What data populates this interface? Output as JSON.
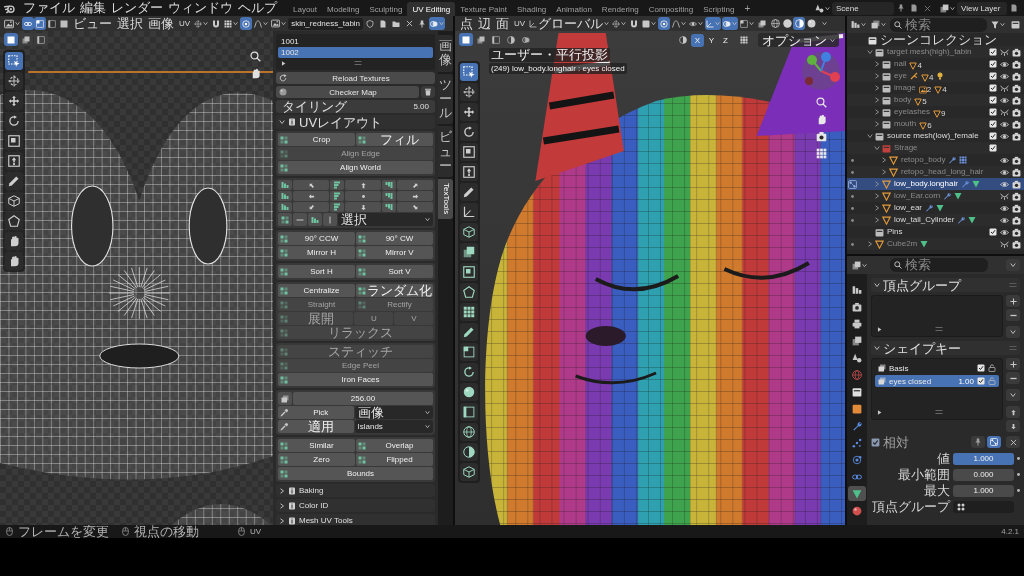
{
  "top_bar": {
    "menus": [
      "ファイル",
      "編集",
      "レンダー",
      "ウィンドウ",
      "ヘルプ"
    ],
    "workspaces": [
      {
        "label": "Layout",
        "selected": false
      },
      {
        "label": "Modeling",
        "selected": false
      },
      {
        "label": "Sculpting",
        "selected": false
      },
      {
        "label": "UV Editing",
        "selected": true
      },
      {
        "label": "Texture Paint",
        "selected": false
      },
      {
        "label": "Shading",
        "selected": false
      },
      {
        "label": "Animation",
        "selected": false
      },
      {
        "label": "Rendering",
        "selected": false
      },
      {
        "label": "Compositing",
        "selected": false
      },
      {
        "label": "Scripting",
        "selected": false
      }
    ],
    "add_workspace": "+",
    "scene": "Scene",
    "view_layer": "View Layer"
  },
  "uv_editor": {
    "select_toggles": [
      {
        "kind": "sync",
        "selected": true
      },
      {
        "kind": "vertex",
        "selected": true
      },
      {
        "kind": "edge",
        "selected": false
      },
      {
        "kind": "face",
        "selected": false
      }
    ],
    "menus": [
      "ビュー",
      "選択",
      "画像",
      "UV"
    ],
    "header_tools": [
      {
        "kind": "pivot",
        "selected": false
      },
      {
        "kind": "snap",
        "selected": false
      },
      {
        "kind": "snap_target",
        "selected": false
      },
      {
        "kind": "proportional",
        "selected": true
      },
      {
        "kind": "falloff",
        "selected": false
      }
    ],
    "image_name": "skin_redness_tabin",
    "overlay": {
      "selected": true
    },
    "select_modes": [
      {
        "kind": "set",
        "selected": true
      },
      {
        "kind": "extend",
        "selected": false
      },
      {
        "kind": "subtract",
        "selected": false
      }
    ],
    "tools": [
      {
        "kind": "select",
        "selected": true
      },
      {
        "kind": "cursor",
        "selected": false
      },
      {
        "kind": "move",
        "selected": false
      },
      {
        "kind": "rotate",
        "selected": false
      },
      {
        "kind": "scale",
        "selected": false
      },
      {
        "kind": "transform",
        "selected": false
      },
      {
        "kind": "annotate",
        "selected": false
      },
      {
        "kind": "rip",
        "selected": false
      },
      {
        "kind": "region",
        "selected": false
      },
      {
        "kind": "grab",
        "selected": false
      },
      {
        "kind": "pinch",
        "selected": false
      }
    ]
  },
  "sidebar": {
    "tiles": [
      {
        "label": "1001",
        "selected": false
      },
      {
        "label": "1002",
        "selected": true
      }
    ],
    "reload_button": "Reload Textures",
    "checker_button": "Checker Map",
    "tiling": {
      "label": "タイリング",
      "value": "5.00"
    },
    "layout_panel": {
      "title": "UVレイアウト",
      "expanded": true,
      "groups": [
        {
          "rows": [
            {
              "kind": "buttons",
              "buttons": [
                {
                  "label": "Crop",
                  "disabled": false
                },
                {
                  "label": "フィル",
                  "disabled": false
                }
              ]
            },
            {
              "kind": "buttons",
              "buttons": [
                {
                  "label": "Align Edge",
                  "disabled": true
                }
              ]
            },
            {
              "kind": "buttons",
              "buttons": [
                {
                  "label": "Align World",
                  "disabled": false
                }
              ]
            }
          ]
        },
        {
          "rows": [
            {
              "kind": "align_grid"
            },
            {
              "kind": "align_select",
              "dropdown": "選択"
            }
          ]
        },
        {
          "rows": [
            {
              "kind": "buttons",
              "buttons": [
                {
                  "label": "90° CCW",
                  "disabled": false
                },
                {
                  "label": "90° CW",
                  "disabled": false
                }
              ]
            },
            {
              "kind": "buttons",
              "buttons": [
                {
                  "label": "Mirror H",
                  "disabled": false
                },
                {
                  "label": "Mirror V",
                  "disabled": false
                }
              ]
            }
          ]
        },
        {
          "rows": [
            {
              "kind": "buttons",
              "buttons": [
                {
                  "label": "Sort H",
                  "disabled": false
                },
                {
                  "label": "Sort V",
                  "disabled": false
                }
              ]
            }
          ]
        },
        {
          "rows": [
            {
              "kind": "buttons",
              "buttons": [
                {
                  "label": "Centralize",
                  "disabled": false
                },
                {
                  "label": "ランダム化",
                  "disabled": false
                }
              ]
            },
            {
              "kind": "buttons",
              "buttons": [
                {
                  "label": "Straight",
                  "disabled": true
                },
                {
                  "label": "Rectify",
                  "disabled": true
                }
              ]
            },
            {
              "kind": "buttons",
              "buttons": [
                {
                  "label": "展開",
                  "disabled": true
                },
                {
                  "label": "U",
                  "disabled": true
                },
                {
                  "label": "V",
                  "disabled": true
                }
              ]
            },
            {
              "kind": "buttons",
              "buttons": [
                {
                  "label": "リラックス",
                  "disabled": true
                }
              ]
            }
          ]
        },
        {
          "rows": [
            {
              "kind": "buttons",
              "buttons": [
                {
                  "label": "スティッチ",
                  "disabled": true
                }
              ]
            },
            {
              "kind": "buttons",
              "buttons": [
                {
                  "label": "Edge Peel",
                  "disabled": true
                }
              ]
            },
            {
              "kind": "buttons",
              "buttons": [
                {
                  "label": "Iron Faces",
                  "disabled": false
                }
              ]
            }
          ]
        },
        {
          "rows": [
            {
              "kind": "value",
              "value": "256.00"
            },
            {
              "kind": "pick",
              "button": {
                "label": "Pick",
                "disabled": false
              },
              "dropdown": "画像"
            },
            {
              "kind": "pick",
              "button": {
                "label": "適用",
                "disabled": false
              },
              "dropdown": "Islands"
            }
          ]
        },
        {
          "rows": [
            {
              "kind": "buttons",
              "buttons": [
                {
                  "label": "Similar",
                  "disabled": false
                },
                {
                  "label": "Overlap",
                  "disabled": false
                }
              ]
            },
            {
              "kind": "buttons",
              "buttons": [
                {
                  "label": "Zero",
                  "disabled": false
                },
                {
                  "label": "Flipped",
                  "disabled": false
                }
              ]
            },
            {
              "kind": "buttons",
              "buttons": [
                {
                  "label": "Bounds",
                  "disabled": false
                }
              ]
            }
          ]
        }
      ]
    },
    "collapsed_panels": [
      {
        "title": "Baking",
        "expanded": false
      },
      {
        "title": "Color ID",
        "expanded": false
      },
      {
        "title": "Mesh UV Tools",
        "expanded": false
      }
    ],
    "tabs": [
      {
        "label": "画像",
        "selected": false,
        "kind": "stacked"
      },
      {
        "label": "ツール",
        "selected": false,
        "kind": "stacked"
      },
      {
        "label": "ビュー",
        "selected": false,
        "kind": "stacked"
      },
      {
        "label": "TexTools",
        "selected": true,
        "kind": "rotated"
      }
    ]
  },
  "viewport": {
    "menus": [
      "点",
      "辺",
      "面",
      "UV"
    ],
    "orientation": "グローバル",
    "header_tools": [
      {
        "kind": "pivot",
        "selected": false
      },
      {
        "kind": "snap",
        "selected": false
      },
      {
        "kind": "snap_increment",
        "selected": false
      },
      {
        "kind": "proportional",
        "selected": true
      },
      {
        "kind": "falloff",
        "selected": false
      }
    ],
    "display_toggles": [
      {
        "kind": "visibility",
        "selected": false
      },
      {
        "kind": "gizmo",
        "selected": true
      },
      {
        "kind": "overlay",
        "selected": true
      },
      {
        "kind": "mesh_overlay",
        "selected": false
      },
      {
        "kind": "xray",
        "selected": false
      }
    ],
    "shading": [
      {
        "kind": "wireframe",
        "selected": false
      },
      {
        "kind": "solid",
        "selected": false
      },
      {
        "kind": "material",
        "selected": true
      },
      {
        "kind": "rendered",
        "selected": false
      }
    ],
    "select_modes": [
      {
        "kind": "set",
        "selected": true
      },
      {
        "kind": "extend",
        "selected": false
      },
      {
        "kind": "subtract",
        "selected": false
      },
      {
        "kind": "invert",
        "selected": false
      },
      {
        "kind": "intersect",
        "selected": false
      }
    ],
    "mirror": [
      {
        "label": "X",
        "selected": true
      },
      {
        "label": "Y",
        "selected": false
      },
      {
        "label": "Z",
        "selected": false
      }
    ],
    "options": "オプション",
    "view_name": "ユーザー・平行投影",
    "object_info": "(249) low_body.longhair : eyes closed",
    "tools": [
      {
        "kind": "select",
        "selected": true
      },
      {
        "kind": "cursor",
        "selected": false
      },
      {
        "kind": "move",
        "selected": false
      },
      {
        "kind": "rotate",
        "selected": false
      },
      {
        "kind": "scale",
        "selected": false
      },
      {
        "kind": "transform",
        "selected": false
      },
      {
        "kind": "annotate",
        "selected": false
      },
      {
        "kind": "measure",
        "selected": false
      },
      {
        "kind": "add_cube",
        "selected": false
      },
      {
        "kind": "extrude",
        "selected": false
      },
      {
        "kind": "inset",
        "selected": false
      },
      {
        "kind": "bevel",
        "selected": false
      },
      {
        "kind": "loop_cut",
        "selected": false
      },
      {
        "kind": "knife",
        "selected": false
      },
      {
        "kind": "poly_build",
        "selected": false
      },
      {
        "kind": "spin",
        "selected": false
      },
      {
        "kind": "smooth",
        "selected": false
      },
      {
        "kind": "edge_slide",
        "selected": false
      },
      {
        "kind": "shrink",
        "selected": false
      },
      {
        "kind": "shear",
        "selected": false
      },
      {
        "kind": "rip",
        "selected": false
      }
    ]
  },
  "outliner": {
    "search_placeholder": "検索",
    "tree": [
      {
        "name": "シーンコレクション",
        "kind": "scene",
        "selected": false,
        "dimmed": false,
        "children": [
          {
            "name": "target mesh(high)_tabin",
            "kind": "collection",
            "expanded": true,
            "selected": false,
            "dimmed": true,
            "included": true,
            "visible": false,
            "renderable": true,
            "children": [
              {
                "name": "nail",
                "kind": "collection",
                "expanded": false,
                "selected": false,
                "dimmed": true,
                "included": true,
                "visible": true,
                "renderable": true,
                "badges": [
                  {
                    "kind": "mesh",
                    "count": "4"
                  }
                ]
              },
              {
                "name": "eye",
                "kind": "collection",
                "expanded": false,
                "selected": false,
                "dimmed": true,
                "included": true,
                "visible": true,
                "renderable": true,
                "badges": [
                  {
                    "kind": "armature"
                  },
                  {
                    "kind": "mesh",
                    "count": "4"
                  },
                  {
                    "kind": "light"
                  }
                ]
              },
              {
                "name": "image",
                "kind": "collection",
                "expanded": false,
                "selected": false,
                "dimmed": true,
                "included": true,
                "visible": false,
                "renderable": true,
                "badges": [
                  {
                    "kind": "image",
                    "count": "2"
                  },
                  {
                    "kind": "mesh",
                    "count": "4"
                  }
                ]
              },
              {
                "name": "body",
                "kind": "collection",
                "expanded": false,
                "selected": false,
                "dimmed": true,
                "included": true,
                "visible": true,
                "renderable": true,
                "badges": [
                  {
                    "kind": "mesh",
                    "count": "5"
                  }
                ]
              },
              {
                "name": "eyelashes",
                "kind": "collection",
                "expanded": false,
                "selected": false,
                "dimmed": true,
                "included": true,
                "visible": false,
                "renderable": true,
                "badges": [
                  {
                    "kind": "mesh",
                    "count": "9"
                  }
                ]
              },
              {
                "name": "mouth",
                "kind": "collection",
                "expanded": false,
                "selected": false,
                "dimmed": true,
                "included": true,
                "visible": true,
                "renderable": true,
                "badges": [
                  {
                    "kind": "mesh",
                    "count": "6"
                  }
                ]
              }
            ]
          },
          {
            "name": "source mesh(low)_female",
            "kind": "collection",
            "expanded": true,
            "selected": false,
            "dimmed": false,
            "included": true,
            "visible": true,
            "renderable": true,
            "children": [
              {
                "name": "Strage",
                "kind": "collection",
                "color": "#c0403c",
                "expanded": true,
                "selected": false,
                "dimmed": true,
                "included": true,
                "children": [
                  {
                    "name": "retopo_body",
                    "kind": "mesh",
                    "expanded": false,
                    "selected": false,
                    "dimmed": true,
                    "visible": true,
                    "renderable": true,
                    "badges": [
                      {
                        "kind": "modifier"
                      },
                      {
                        "kind": "grid"
                      }
                    ]
                  },
                  {
                    "name": "retopo_head_long_hair",
                    "kind": "mesh",
                    "expanded": false,
                    "selected": false,
                    "dimmed": true,
                    "visible": true,
                    "renderable": true
                  }
                ]
              },
              {
                "name": "low_body.longhair",
                "kind": "mesh",
                "expanded": false,
                "selected": true,
                "dimmed": false,
                "visible": true,
                "renderable": true,
                "badges": [
                  {
                    "kind": "modifier"
                  },
                  {
                    "kind": "data"
                  }
                ]
              },
              {
                "name": "low_Ear.corn",
                "kind": "mesh",
                "expanded": false,
                "selected": false,
                "dimmed": true,
                "visible": false,
                "renderable": true,
                "badges": [
                  {
                    "kind": "modifier"
                  },
                  {
                    "kind": "data"
                  }
                ]
              },
              {
                "name": "low_ear",
                "kind": "mesh",
                "expanded": false,
                "selected": false,
                "dimmed": false,
                "visible": true,
                "renderable": true,
                "badges": [
                  {
                    "kind": "modifier"
                  },
                  {
                    "kind": "data"
                  }
                ]
              },
              {
                "name": "low_tail_Cylinder",
                "kind": "mesh",
                "expanded": false,
                "selected": false,
                "dimmed": false,
                "visible": true,
                "renderable": true,
                "badges": [
                  {
                    "kind": "modifier"
                  },
                  {
                    "kind": "data"
                  }
                ]
              }
            ]
          },
          {
            "name": "Pins",
            "kind": "collection",
            "selected": false,
            "dimmed": false,
            "included": true,
            "visible": true,
            "renderable": true
          },
          {
            "name": "Cube2m",
            "kind": "mesh",
            "expanded": false,
            "selected": false,
            "dimmed": true,
            "visible": false,
            "renderable": true,
            "badges": [
              {
                "kind": "data"
              }
            ]
          }
        ]
      }
    ]
  },
  "properties": {
    "search_placeholder": "検索",
    "tabs": [
      {
        "kind": "tool",
        "selected": false
      },
      {
        "kind": "render",
        "selected": false
      },
      {
        "kind": "output",
        "selected": false
      },
      {
        "kind": "view_layer",
        "selected": false
      },
      {
        "kind": "scene",
        "selected": false
      },
      {
        "kind": "world",
        "selected": false
      },
      {
        "kind": "collection",
        "selected": false
      },
      {
        "kind": "object",
        "selected": false
      },
      {
        "kind": "modifier",
        "selected": false
      },
      {
        "kind": "particles",
        "selected": false
      },
      {
        "kind": "physics",
        "selected": false
      },
      {
        "kind": "constraints",
        "selected": false
      },
      {
        "kind": "data",
        "selected": true
      },
      {
        "kind": "material",
        "selected": false
      }
    ],
    "vertex_groups": {
      "title": "頂点グループ",
      "expanded": true
    },
    "shape_keys": {
      "title": "シェイプキー",
      "expanded": true,
      "keys": [
        {
          "name": "Basis",
          "checked": true,
          "selected": false
        },
        {
          "name": "eyes closed",
          "value": "1.00",
          "checked": true,
          "selected": true
        }
      ],
      "relative": {
        "label": "相対",
        "checked": true,
        "disabled": true
      },
      "toggles": [
        {
          "kind": "pin",
          "selected": false
        },
        {
          "kind": "edit_mode",
          "selected": true
        }
      ],
      "fields": [
        {
          "label": "値",
          "kind": "slider",
          "value": "1.000",
          "level": 1
        },
        {
          "label": "最小範囲",
          "kind": "number",
          "value": "0.000"
        },
        {
          "label": "最大",
          "kind": "number",
          "value": "1.000"
        },
        {
          "label": "頂点グループ",
          "kind": "search"
        }
      ]
    }
  },
  "status_bar": {
    "hints": [
      "フレームを変更",
      "視点の移動",
      "UV"
    ],
    "version": "4.2.1"
  }
}
